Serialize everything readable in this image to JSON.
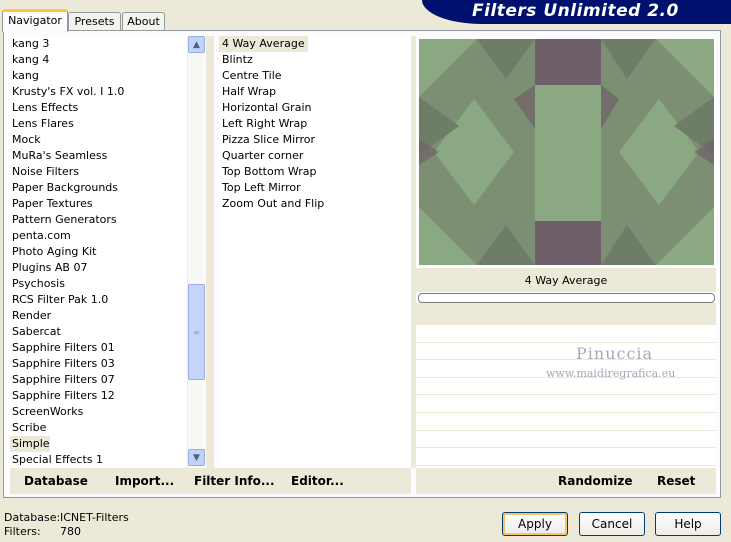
{
  "tabs": [
    "Navigator",
    "Presets",
    "About"
  ],
  "banner_title": "Filters Unlimited 2.0",
  "filters": [
    "kang 3",
    "kang 4",
    "kang",
    "Krusty's FX vol. I 1.0",
    "Lens Effects",
    "Lens Flares",
    "Mock",
    "MuRa's Seamless",
    "Noise Filters",
    "Paper Backgrounds",
    "Paper Textures",
    "Pattern Generators",
    "penta.com",
    "Photo Aging Kit",
    "Plugins AB 07",
    "Psychosis",
    "RCS Filter Pak 1.0",
    "Render",
    "Sabercat",
    "Sapphire Filters 01",
    "Sapphire Filters 03",
    "Sapphire Filters 07",
    "Sapphire Filters 12",
    "ScreenWorks",
    "Scribe",
    "Simple",
    "Special Effects 1"
  ],
  "selected_filter": "Simple",
  "effects": [
    "4 Way Average",
    "Blintz",
    "Centre Tile",
    "Half Wrap",
    "Horizontal Grain",
    "Left Right Wrap",
    "Pizza Slice Mirror",
    "Quarter corner",
    "Top Bottom Wrap",
    "Top Left Mirror",
    "Zoom Out and Flip"
  ],
  "selected_effect": "4 Way Average",
  "preview_caption": "4 Way Average",
  "watermark": {
    "name": "Pinuccia",
    "url": "www.maidiregrafica.eu"
  },
  "panel_buttons": {
    "database": "Database",
    "import": "Import...",
    "filter_info": "Filter Info...",
    "editor": "Editor...",
    "randomize": "Randomize",
    "reset": "Reset"
  },
  "footer": {
    "database_label": "Database:",
    "database_value": "ICNET-Filters",
    "filters_label": "Filters:",
    "filters_value": "780"
  },
  "dialog_buttons": {
    "apply": "Apply",
    "cancel": "Cancel",
    "help": "Help"
  },
  "icons": {
    "scroll_up": "scroll-up-arrow-icon",
    "scroll_down": "scroll-down-arrow-icon"
  },
  "colors": {
    "banner": "#00106e",
    "preview_green": "#8aa882",
    "preview_mauve": "#6f5f69",
    "window_bg": "#ece9d8"
  }
}
